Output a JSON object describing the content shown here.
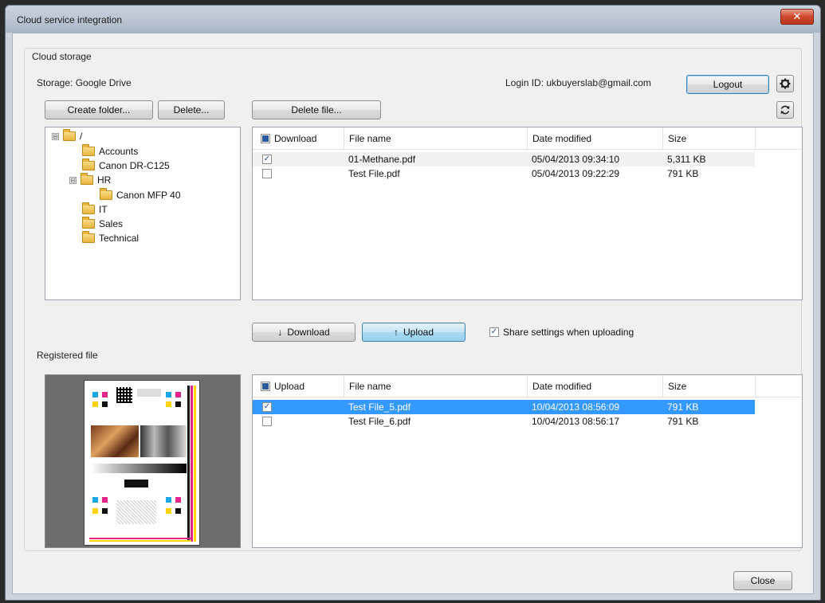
{
  "window": {
    "title": "Cloud service integration",
    "close_glyph": "✕"
  },
  "cloud_storage": {
    "section_label": "Cloud storage",
    "storage_label": "Storage: Google Drive",
    "login_label": "Login ID: ukbuyerslab@gmail.com",
    "logout_label": "Logout",
    "settings_icon": "gear-icon",
    "refresh_icon": "refresh-icon",
    "create_folder_label": "Create folder...",
    "delete_label": "Delete...",
    "delete_file_label": "Delete file...",
    "tree": [
      {
        "label": "/",
        "expander": "⊟"
      },
      {
        "label": "Accounts"
      },
      {
        "label": "Canon DR-C125"
      },
      {
        "label": "HR",
        "expander": "⊟"
      },
      {
        "label": "Canon MFP 40"
      },
      {
        "label": "IT"
      },
      {
        "label": "Sales"
      },
      {
        "label": "Technical"
      }
    ],
    "columns": {
      "check": "Download",
      "name": "File name",
      "date": "Date modified",
      "size": "Size"
    },
    "files": [
      {
        "name": "01-Methane.pdf",
        "date": "05/04/2013 09:34:10",
        "size": "5,311 KB",
        "checked": "✓"
      },
      {
        "name": "Test File.pdf",
        "date": "05/04/2013 09:22:29",
        "size": "791 KB",
        "checked": ""
      }
    ]
  },
  "transfer": {
    "download_label": "Download",
    "download_icon": "↓",
    "upload_label": "Upload",
    "upload_icon": "↑",
    "share_label": "Share settings when uploading",
    "share_checked": "✓"
  },
  "registered": {
    "section_label": "Registered file",
    "columns": {
      "check": "Upload",
      "name": "File name",
      "date": "Date modified",
      "size": "Size"
    },
    "files": [
      {
        "name": "Test File_5.pdf",
        "date": "10/04/2013 08:56:09",
        "size": "791 KB",
        "checked": "✓"
      },
      {
        "name": "Test File_6.pdf",
        "date": "10/04/2013 08:56:17",
        "size": "791 KB",
        "checked": ""
      }
    ]
  },
  "footer": {
    "close_label": "Close"
  },
  "colors": {
    "selection": "#3399ff",
    "cmyk_cyan": "#1aa7e6",
    "cmyk_magenta": "#e5258c",
    "cmyk_yellow": "#ffd400",
    "cmyk_black": "#111111"
  }
}
